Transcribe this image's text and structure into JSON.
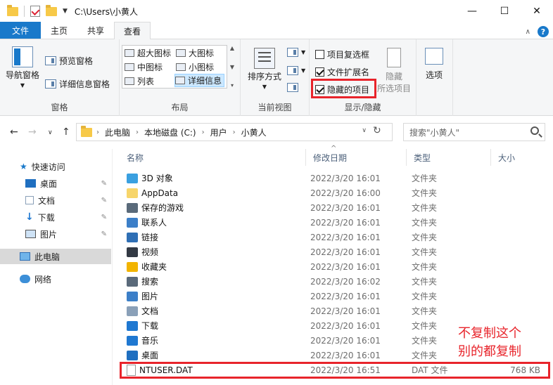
{
  "window": {
    "title": "C:\\Users\\小黄人",
    "minimize": "—",
    "maximize": "☐",
    "close": "✕"
  },
  "tabs": [
    {
      "label": "文件"
    },
    {
      "label": "主页"
    },
    {
      "label": "共享"
    },
    {
      "label": "查看"
    }
  ],
  "ribbon": {
    "panes": {
      "label": "窗格",
      "nav_pane": "导航窗格",
      "preview": "预览窗格",
      "details": "详细信息窗格"
    },
    "layout": {
      "label": "布局",
      "items": [
        "超大图标",
        "大图标",
        "中图标",
        "小图标",
        "列表",
        "详细信息"
      ]
    },
    "current_view": {
      "label": "当前视图",
      "sort": "排序方式"
    },
    "show_hide": {
      "label": "显示/隐藏",
      "item_checkboxes": "项目复选框",
      "file_extensions": "文件扩展名",
      "hidden_items": "隐藏的项目",
      "hide_selected_1": "隐藏",
      "hide_selected_2": "所选项目",
      "item_checkboxes_checked": false,
      "file_extensions_checked": true,
      "hidden_items_checked": true
    },
    "options": "选项"
  },
  "address": {
    "crumbs": [
      "此电脑",
      "本地磁盘 (C:)",
      "用户",
      "小黄人"
    ],
    "search_placeholder": "搜索\"小黄人\""
  },
  "nav": {
    "quick_access": "快速访问",
    "desktop": "桌面",
    "documents": "文档",
    "downloads": "下载",
    "pictures": "图片",
    "this_pc": "此电脑",
    "network": "网络"
  },
  "columns": {
    "name": "名称",
    "date": "修改日期",
    "type": "类型",
    "size": "大小"
  },
  "files": [
    {
      "name": "3D 对象",
      "date": "2022/3/20 16:01",
      "type": "文件夹",
      "size": "",
      "icon": "cube",
      "color": "#3aa0e0"
    },
    {
      "name": "AppData",
      "date": "2022/3/20 16:00",
      "type": "文件夹",
      "size": "",
      "icon": "folder",
      "color": "#f7d56a"
    },
    {
      "name": "保存的游戏",
      "date": "2022/3/20 16:01",
      "type": "文件夹",
      "size": "",
      "icon": "game",
      "color": "#5a6a7a"
    },
    {
      "name": "联系人",
      "date": "2022/3/20 16:01",
      "type": "文件夹",
      "size": "",
      "icon": "contacts",
      "color": "#3c7fc8"
    },
    {
      "name": "链接",
      "date": "2022/3/20 16:01",
      "type": "文件夹",
      "size": "",
      "icon": "link",
      "color": "#2f6fb5"
    },
    {
      "name": "视频",
      "date": "2022/3/20 16:01",
      "type": "文件夹",
      "size": "",
      "icon": "video",
      "color": "#333a44"
    },
    {
      "name": "收藏夹",
      "date": "2022/3/20 16:01",
      "type": "文件夹",
      "size": "",
      "icon": "star",
      "color": "#f2b400"
    },
    {
      "name": "搜索",
      "date": "2022/3/20 16:02",
      "type": "文件夹",
      "size": "",
      "icon": "search",
      "color": "#5a6a7a"
    },
    {
      "name": "图片",
      "date": "2022/3/20 16:01",
      "type": "文件夹",
      "size": "",
      "icon": "picture",
      "color": "#3c7fc8"
    },
    {
      "name": "文档",
      "date": "2022/3/20 16:01",
      "type": "文件夹",
      "size": "",
      "icon": "document",
      "color": "#8aa0b8"
    },
    {
      "name": "下载",
      "date": "2022/3/20 16:01",
      "type": "文件夹",
      "size": "",
      "icon": "download",
      "color": "#1f78d1"
    },
    {
      "name": "音乐",
      "date": "2022/3/20 16:01",
      "type": "文件夹",
      "size": "",
      "icon": "music",
      "color": "#1f78d1"
    },
    {
      "name": "桌面",
      "date": "2022/3/20 16:01",
      "type": "文件夹",
      "size": "",
      "icon": "desktop",
      "color": "#1f6fc0"
    },
    {
      "name": "NTUSER.DAT",
      "date": "2022/3/20 16:51",
      "type": "DAT 文件",
      "size": "768 KB",
      "icon": "file",
      "color": "#ffffff"
    }
  ],
  "annotation": {
    "line1": "不复制这个",
    "line2": "别的都复制"
  },
  "accent": "#1979ca",
  "highlight": "#e8242b"
}
